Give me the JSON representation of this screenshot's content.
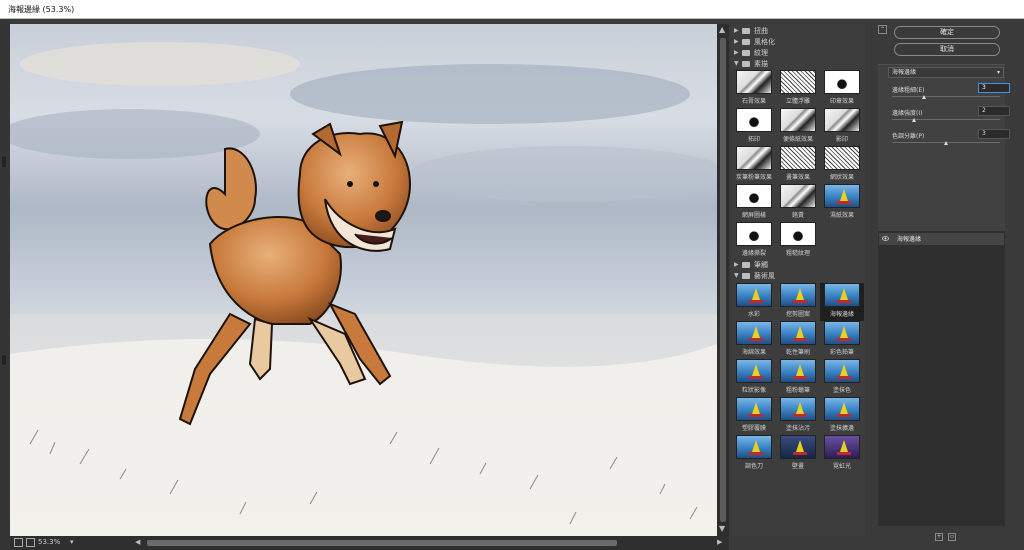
{
  "window": {
    "title": "海報邊緣 (53.3%)"
  },
  "status": {
    "zoom_label": "53.3%",
    "zoom_caret": "▾"
  },
  "gallery": {
    "categories": {
      "artistic_top": "扭曲",
      "brush": "風格化",
      "texture": "紋理",
      "sketch": "素描",
      "brush_strokes": "筆觸",
      "artistic": "藝術風"
    },
    "sketch_filters": [
      "石膏效果",
      "立體浮雕",
      "印章效果",
      "拓印",
      "便條紙效果",
      "影印",
      "炭筆粉筆效果",
      "畫筆效果",
      "網狀效果",
      "網屏圖樣",
      "鉻黃",
      "濕紙效果",
      "邊緣撕裂",
      "粗糙紋理"
    ],
    "artistic_filters": [
      "水彩",
      "挖剪圖案",
      "海報邊緣",
      "海綿效果",
      "乾性筆刷",
      "彩色鉛筆",
      "粒狀影像",
      "粗粉蠟筆",
      "塗抹色",
      "塑膠覆膜",
      "塗抹沾污",
      "塗抹擴邊",
      "調色刀",
      "壁畫",
      "霓虹光"
    ],
    "selected_filter": "海報邊緣"
  },
  "panel": {
    "ok_label": "確定",
    "cancel_label": "取消",
    "filter_select": "海報邊緣",
    "params": [
      {
        "label": "邊緣粗細(E)",
        "value": "3",
        "fraction": 0.3
      },
      {
        "label": "邊緣強度(I)",
        "value": "2",
        "fraction": 0.2
      },
      {
        "label": "色調分離(P)",
        "value": "3",
        "fraction": 0.5
      }
    ],
    "layer_name": "海報邊緣"
  },
  "colors": {
    "accent": "#4a90e2",
    "panel_bg": "#3a3a3a",
    "gallery_bg": "#3d3d3d"
  },
  "icons": [
    "folder-icon",
    "eye-icon",
    "new-layer-icon",
    "delete-icon",
    "collapse-icon"
  ]
}
